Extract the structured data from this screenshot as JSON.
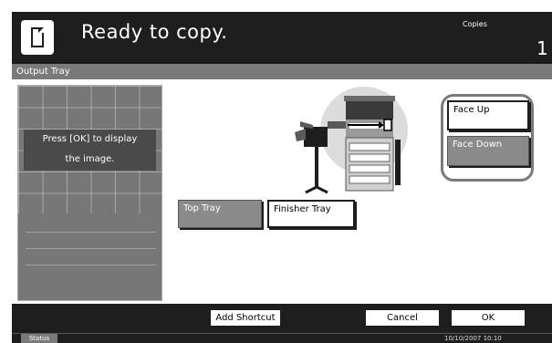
{
  "header": {
    "title": "Ready to copy.",
    "copies_label": "Copies",
    "copies_value": "1"
  },
  "panel": {
    "title": "Output Tray"
  },
  "preview": {
    "message_line1": "Press [OK] to display",
    "message_line2": "the image."
  },
  "tray_options": {
    "top_tray": "Top Tray",
    "finisher_tray": "Finisher Tray",
    "selected": "Finisher Tray"
  },
  "face_options": {
    "face_up": "Face Up",
    "face_down": "Face Down",
    "selected": "Face Up"
  },
  "footer": {
    "add_shortcut": "Add Shortcut",
    "cancel": "Cancel",
    "ok": "OK"
  },
  "statusbar": {
    "status_label": "Status",
    "datetime": "10/10/2007   10:10"
  },
  "icons": {
    "document": "document-icon",
    "machine": "copier-machine-icon"
  }
}
